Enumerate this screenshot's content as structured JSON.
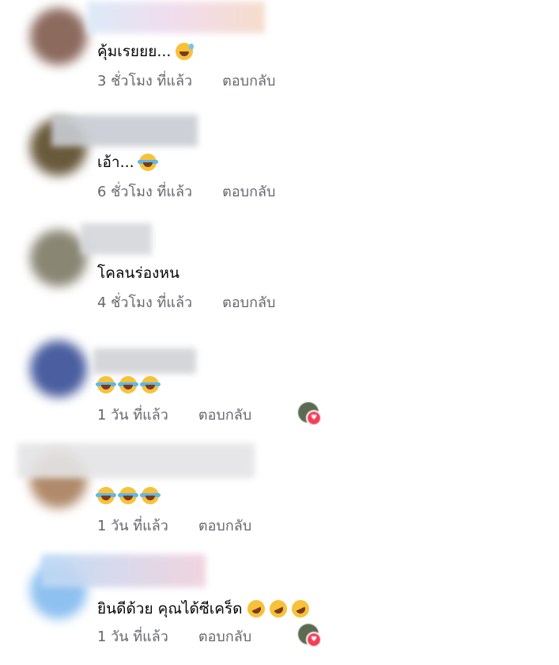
{
  "comments": [
    {
      "text": "คุ้มเรยยย...",
      "time": "3 ชั่วโมง ที่แล้ว",
      "reply": "ตอบกลับ"
    },
    {
      "text": "เอ้า...",
      "time": "6 ชั่วโมง ที่แล้ว",
      "reply": "ตอบกลับ"
    },
    {
      "text": "โคลนร่องหน",
      "time": "4 ชั่วโมง ที่แล้ว",
      "reply": "ตอบกลับ"
    },
    {
      "text": "",
      "time": "1 วัน ที่แล้ว",
      "reply": "ตอบกลับ"
    },
    {
      "text": "",
      "time": "1 วัน ที่แล้ว",
      "reply": "ตอบกลับ"
    },
    {
      "text": "ยินดีด้วย คุณได้ซีเคร็ด",
      "time": "1 วัน ที่แล้ว",
      "reply": "ตอบกลับ"
    }
  ],
  "emojis": {
    "c0": [
      "sweat-smile-emoji"
    ],
    "c1": [
      "tears-of-joy-emoji"
    ],
    "c3": [
      "tears-of-joy-emoji",
      "tears-of-joy-emoji",
      "tears-of-joy-emoji"
    ],
    "c4": [
      "tears-of-joy-emoji",
      "tears-of-joy-emoji",
      "tears-of-joy-emoji"
    ],
    "c5": [
      "rofl-emoji",
      "rofl-emoji",
      "rofl-emoji"
    ]
  },
  "reaction_heart_icon": "heart-icon",
  "colors": {
    "meta": "#65676b",
    "text": "#050505",
    "heart": "#f33e58"
  }
}
